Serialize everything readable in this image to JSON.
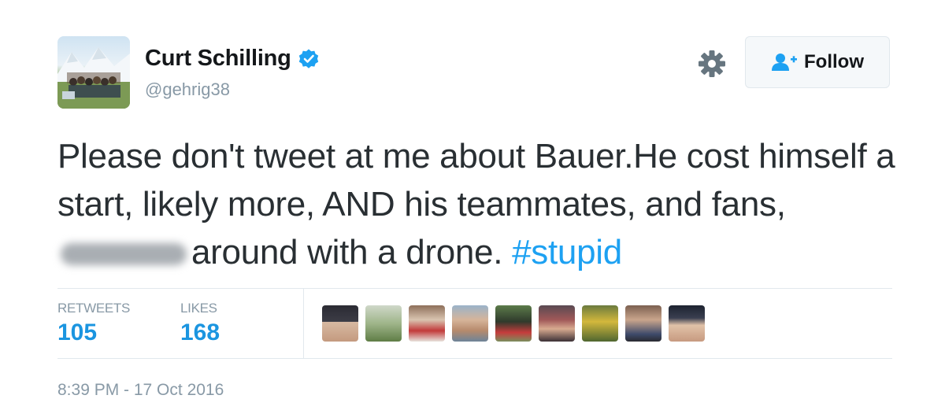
{
  "user": {
    "name": "Curt Schilling",
    "handle": "@gehrig38",
    "verified": true
  },
  "actions": {
    "follow_label": "Follow"
  },
  "tweet": {
    "text_before_redaction": "Please don't tweet at me about Bauer.He cost himself a start, likely more, AND his teammates, and fans,",
    "text_after_redaction": "around with a drone.",
    "hashtag": "#stupid"
  },
  "stats": {
    "retweets_label": "RETWEETS",
    "retweets_value": "105",
    "likes_label": "LIKES",
    "likes_value": "168"
  },
  "timestamp": "8:39 PM - 17 Oct 2016",
  "colors": {
    "link": "#1da1f2",
    "stat_value": "#1b95e0",
    "muted": "#8899a6",
    "text": "#292f33",
    "verified": "#1da1f2"
  },
  "icons": {
    "verified": "verified-badge-icon",
    "settings": "gear-icon",
    "follow": "add-user-icon"
  }
}
